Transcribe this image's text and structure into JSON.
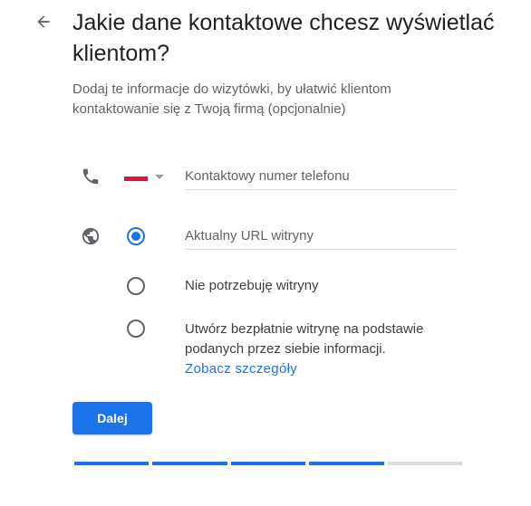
{
  "header": {
    "back_icon": "arrow-back-icon",
    "title": "Jakie dane kontaktowe chcesz wyświetlać klientom?",
    "subtitle": "Dodaj te informacje do wizytówki, by ułatwić klientom kontaktowanie się z Twoją firmą (opcjonalnie)"
  },
  "phone": {
    "icon": "phone-icon",
    "country_flag": "pl-flag",
    "placeholder": "Kontaktowy numer telefonu"
  },
  "website": {
    "icon": "globe-icon",
    "options": [
      {
        "label": "Aktualny URL witryny",
        "checked": true
      },
      {
        "label": "Nie potrzebuję witryny",
        "checked": false
      },
      {
        "label": "Utwórz bezpłatnie witrynę na podstawie podanych przez siebie informacji.",
        "checked": false
      }
    ],
    "details_link": "Zobacz szczegóły"
  },
  "actions": {
    "next_label": "Dalej"
  },
  "progress": {
    "completed_steps": 4,
    "total_steps": 5
  },
  "colors": {
    "accent": "#1a73e8",
    "flag_red": "#dc143c",
    "divider": "#dadce0"
  }
}
